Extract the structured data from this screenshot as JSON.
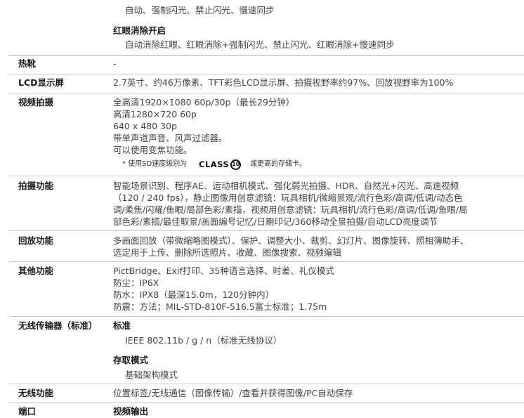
{
  "flash": {
    "modes_line": "自动、强制闪光、禁止闪光、慢速同步",
    "redeye_title": "红眼消除开启",
    "redeye_line": "自动消除红眼、红眼消除+强制闪光、禁止闪光、红眼消除+慢速同步"
  },
  "hotshoe": {
    "label": "热靴",
    "value": "-"
  },
  "lcd": {
    "label": "LCD显示屏",
    "value": "2.7英寸、约46万像素、TFT彩色LCD显示屏、拍摄视野率约97%、回放视野率为100%"
  },
  "video": {
    "label": "视频拍摄",
    "lines": [
      "全高清1920×1080 60p/30p（最长29分钟）",
      "高清1280×720 60p",
      "640 x 480 30p",
      "带单声道声音、风声过滤器。",
      "可以使用变焦功能。"
    ],
    "note_prefix": "* 使用SD速度级别为",
    "class_word": "CLASS",
    "class_num": "10",
    "note_suffix": "或更高的存储卡。"
  },
  "shooting": {
    "label": "拍摄功能",
    "lines": [
      "智能场景识别、程序AE、运动相机模式、强化弱光拍摄、HDR、自然光+闪光、高速视频",
      "（120 / 240 fps），静止图像用创意滤镜：玩具相机/微缩景观/流行色彩/高调/低调/动态色",
      "调/柔焦/闪耀/鱼眼/局部色彩/素描，视频用创意滤镜：玩具相机/流行色彩/高调/低调/鱼眼/局",
      "部色彩/素描/最佳取景/画面编号记忆/日期印记/360移动全景拍摄/自动LCD亮度调节"
    ]
  },
  "playback": {
    "label": "回放功能",
    "lines": [
      "多画面回放（带微缩略图模式）、保护、调整大小、裁剪、幻灯片、图像旋转、照相簿助手、",
      "选定用于上传、删除所选照片、收藏、图像搜索、视频编辑"
    ]
  },
  "other": {
    "label": "其他功能",
    "lines": [
      "PictBridge、Exif打印、35种语言选择、时差、礼仪模式",
      "防尘：IP6X",
      "防水：IPX8（最深15.0m，120分钟内）",
      "防震：方法；MIL-STD-810F-516.5富士标准；1.75m"
    ]
  },
  "wireless_transmitter": {
    "label": "无线传输器（标准）",
    "standard_title": "标准",
    "standard_value": "IEEE 802.11b / g / n（标准无线协议）",
    "access_title": "存取模式",
    "access_value": "基础架构模式"
  },
  "wireless_function": {
    "label": "无线功能",
    "value": "位置标签/无线通信（图像传输）/查看并获得图像/PC自动保存"
  },
  "port": {
    "label": "端口",
    "sub_title": "视频输出"
  }
}
